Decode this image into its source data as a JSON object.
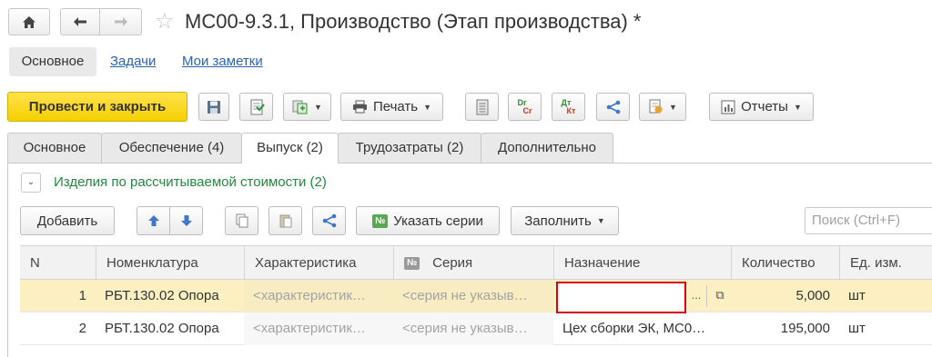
{
  "nav": {
    "home_icon": "home-icon",
    "back_icon": "arrow-left-icon",
    "forward_icon": "arrow-right-icon",
    "star_icon": "star-icon"
  },
  "title": "МС00-9.3.1, Производство (Этап производства) *",
  "sections": {
    "main": "Основное",
    "tasks": "Задачи",
    "notes": "Мои заметки"
  },
  "toolbar": {
    "post_close": "Провести и закрыть",
    "print": "Печать",
    "reports": "Отчеты",
    "dt_kt_top": "Dr",
    "dt_kt_bottom": "Cr",
    "dt_ru_top": "Дт",
    "dt_ru_bottom": "Кт"
  },
  "tabs": [
    "Основное",
    "Обеспечение (4)",
    "Выпуск (2)",
    "Трудозатраты (2)",
    "Дополнительно"
  ],
  "group": {
    "title": "Изделия по рассчитываемой стоимости (2)"
  },
  "table_toolbar": {
    "add": "Добавить",
    "series_badge": "№",
    "specify_series": "Указать серии",
    "fill": "Заполнить",
    "search_placeholder": "Поиск (Ctrl+F)"
  },
  "columns": [
    "N",
    "Номенклатура",
    "Характеристика",
    "Серия",
    "Назначение",
    "Количество",
    "Ед. изм."
  ],
  "rows": [
    {
      "n": "1",
      "item": "РБТ.130.02 Опора",
      "char": "<характеристик…",
      "series": "<серия не указыв…",
      "purpose": "",
      "qty": "5,000",
      "unit": "шт"
    },
    {
      "n": "2",
      "item": "РБТ.130.02 Опора",
      "char": "<характеристик…",
      "series": "<серия не указыв…",
      "purpose": "Цех сборки ЭК, МС0…",
      "qty": "195,000",
      "unit": "шт"
    }
  ],
  "edit_buttons": {
    "select": "...",
    "open": "⧉"
  },
  "colors": {
    "primary": "#f5d000",
    "link": "#2a62b6",
    "group_title": "#22873f",
    "selected_row": "#fcf0c2",
    "edit_border": "#d9001b"
  }
}
